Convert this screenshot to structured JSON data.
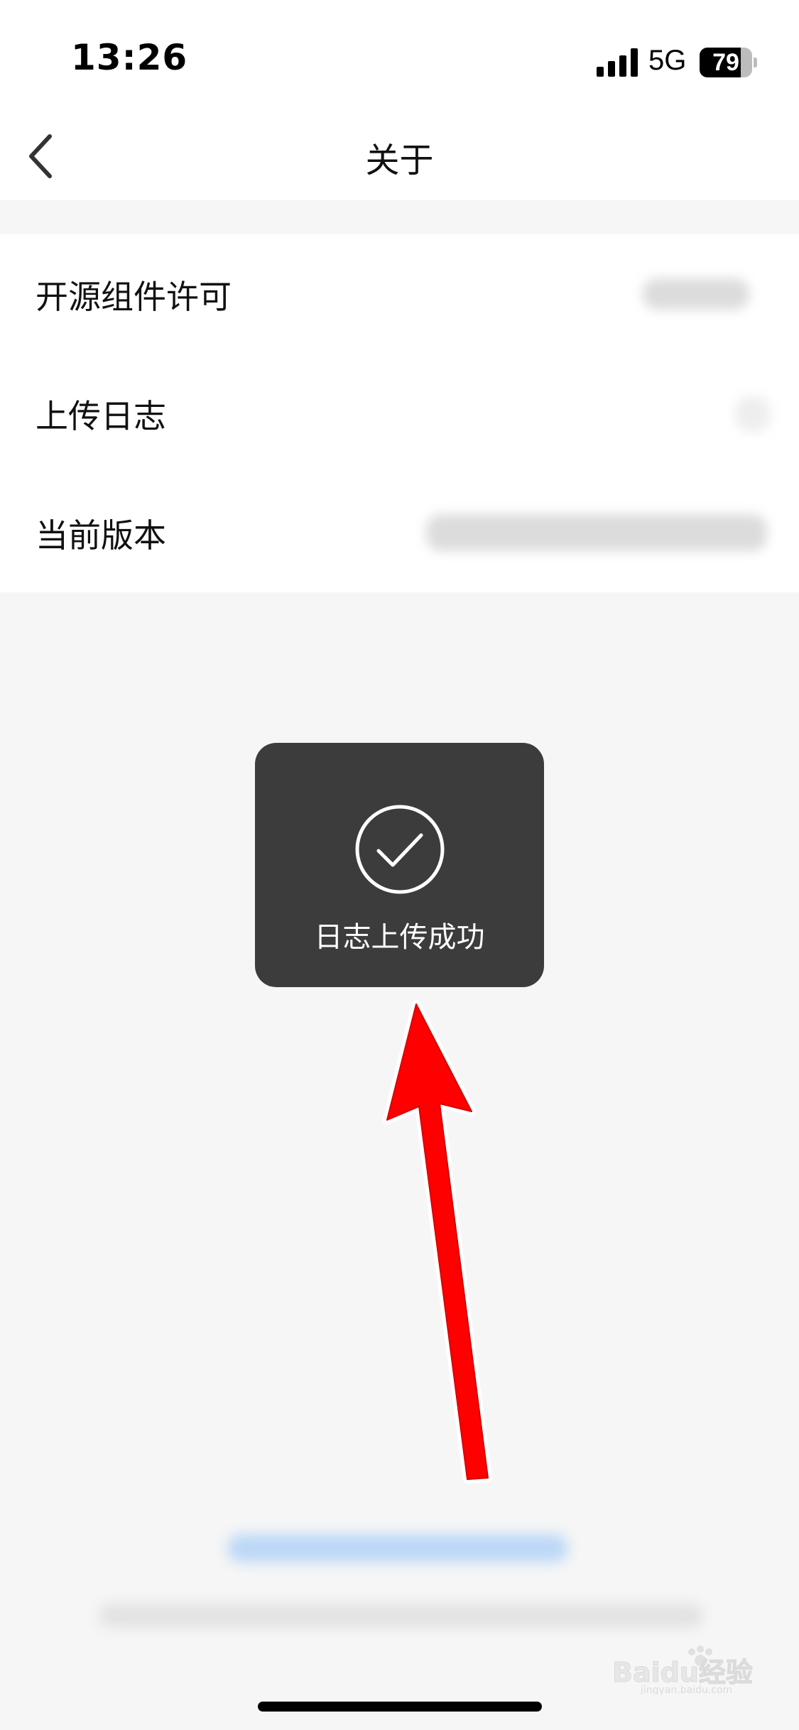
{
  "status_bar": {
    "time": "13:26",
    "network": "5G",
    "battery_level": "79",
    "battery_fraction": 0.79
  },
  "nav": {
    "back_icon": "chevron-left-icon",
    "title": "关于"
  },
  "settings": {
    "items": [
      {
        "label": "开源组件许可"
      },
      {
        "label": "上传日志"
      },
      {
        "label": "当前版本"
      }
    ]
  },
  "toast": {
    "icon": "check-circle-icon",
    "message": "日志上传成功"
  },
  "annotation": {
    "arrow_color": "#ff0000"
  },
  "watermark": {
    "text": "Baidu经验",
    "subtext": "jingyan.baidu.com"
  },
  "colors": {
    "page_background": "#f6f6f6",
    "toast_background": "#3c3c3c"
  }
}
